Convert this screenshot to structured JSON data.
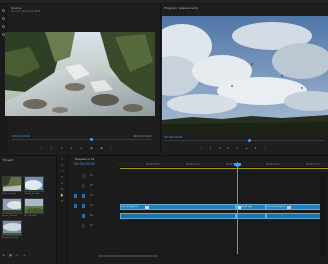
{
  "source_monitor": {
    "title": "Source",
    "subtitle": "Source: Mix_River.MP4",
    "timecode_in": "00:00:20:04",
    "timecode_out": "00:00:26:04"
  },
  "program_monitor": {
    "title": "Program: Sequence 01",
    "timecode": "00:00:20:04"
  },
  "project": {
    "title": "Project",
    "clips": [
      "River_01.mp4",
      "Clouds_02.mp4",
      "Forest_03.mp4",
      "Sky_04.mp4",
      "Stream_05.mp4"
    ]
  },
  "timeline": {
    "title": "Sequence 01",
    "timecode": "00:00:20:04",
    "ruler_labels": [
      "00:00:05:00",
      "00:00:10:00",
      "00:00:15:00",
      "00:00:20:00",
      "00:00:25:00"
    ],
    "tracks": [
      "V3",
      "V2",
      "V1",
      "A1",
      "A2",
      "A3"
    ],
    "clip_labels": [
      "River_01.mp4 [V]",
      "Clouds_02.mp4",
      "Stream_05.mp4 [V]"
    ]
  },
  "colors": {
    "accent": "#3aa0ff",
    "clip": "#2a7fb3",
    "track_highlight": "#2a6ea6"
  }
}
